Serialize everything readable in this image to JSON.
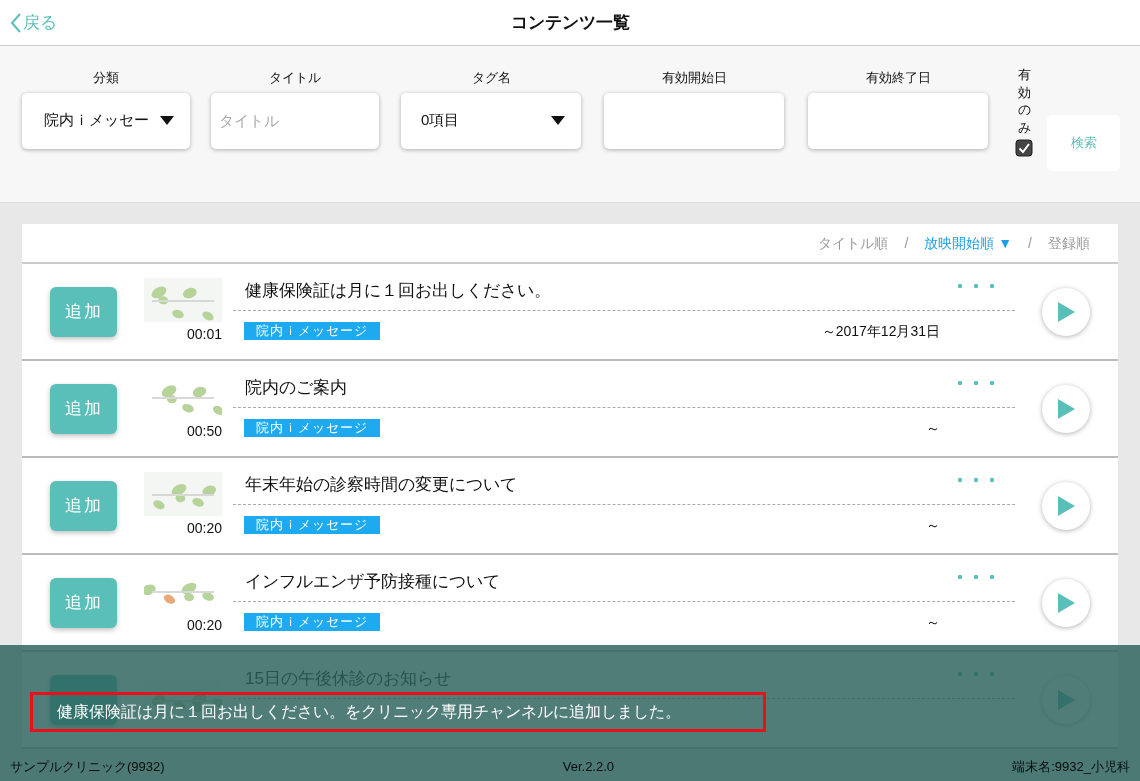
{
  "header": {
    "back_label": "戻る",
    "title": "コンテンツ一覧"
  },
  "filters": {
    "category": {
      "label": "分類",
      "value": "院内ｉメッセー"
    },
    "title": {
      "label": "タイトル",
      "placeholder": "タイトル"
    },
    "tag": {
      "label": "タグ名",
      "value": "0項目"
    },
    "start_date": {
      "label": "有効開始日"
    },
    "end_date": {
      "label": "有効終了日"
    },
    "valid_only": {
      "label": "有効のみ",
      "checked": true
    },
    "search_button": "検索"
  },
  "sort": {
    "options": [
      {
        "label": "タイトル順",
        "selected": false
      },
      {
        "label": "放映開始順 ▼",
        "selected": true
      },
      {
        "label": "登録順",
        "selected": false
      }
    ],
    "separators": [
      "/",
      "/"
    ]
  },
  "rows": [
    {
      "add_label": "追加",
      "duration": "00:01",
      "title": "健康保険証は月に１回お出しください。",
      "tag": "院内ｉメッセージ",
      "period": "～2017年12月31日"
    },
    {
      "add_label": "追加",
      "duration": "00:50",
      "title": "院内のご案内",
      "tag": "院内ｉメッセージ",
      "period": "～"
    },
    {
      "add_label": "追加",
      "duration": "00:20",
      "title": "年末年始の診察時間の変更について",
      "tag": "院内ｉメッセージ",
      "period": "～"
    },
    {
      "add_label": "追加",
      "duration": "00:20",
      "title": "インフルエンザ予防接種について",
      "tag": "院内ｉメッセージ",
      "period": "～"
    },
    {
      "title": "15日の午後休診のお知らせ"
    }
  ],
  "footer": {
    "clinic": "サンプルクリニック(9932)",
    "version": "Ver.2.2.0",
    "terminal": "端末名:9932_小児科"
  },
  "toast": {
    "message": "健康保険証は月に１回お出しください。をクリニック専用チャンネルに追加しました。"
  }
}
